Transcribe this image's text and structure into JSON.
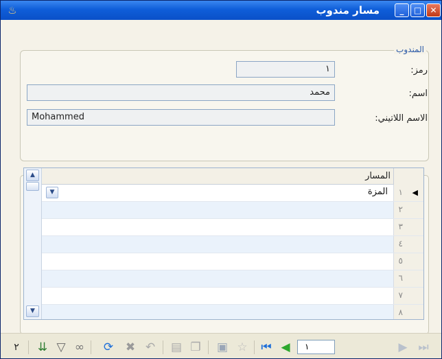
{
  "window": {
    "title": "مسار مندوب",
    "buttons": {
      "minimize": "_",
      "maximize": "□",
      "close": "✕"
    }
  },
  "agent_group": {
    "legend": "المندوب",
    "code_label": "رمز:",
    "code_value": "١",
    "name_label": "اسم:",
    "name_value": "محمد",
    "latin_label": "الاسم اللاتيني:",
    "latin_value": "Mohammed"
  },
  "grid": {
    "column_header": "المسار",
    "rows": [
      {
        "num": "١",
        "value": "المزة",
        "current": true
      },
      {
        "num": "٢",
        "value": ""
      },
      {
        "num": "٣",
        "value": ""
      },
      {
        "num": "٤",
        "value": ""
      },
      {
        "num": "٥",
        "value": ""
      },
      {
        "num": "٦",
        "value": ""
      },
      {
        "num": "٧",
        "value": ""
      },
      {
        "num": "٨",
        "value": ""
      }
    ],
    "colors": {
      "alt_row": "#EAF2FB",
      "header": "#F3F0E6"
    }
  },
  "toolbar": {
    "count": "٢",
    "record_number": "١",
    "icons": [
      "sort-icon",
      "filter-icon",
      "view-icon",
      "refresh-icon",
      "delete-icon",
      "undo-icon",
      "paste-icon",
      "copy-icon",
      "save-icon",
      "favorite-icon",
      "first-record-icon",
      "previous-record-icon",
      "next-record-icon",
      "last-record-icon"
    ]
  },
  "colors": {
    "title_bar": "#0F5ED9",
    "legend": "#2B5AA8",
    "field_border": "#8AA5C4"
  }
}
